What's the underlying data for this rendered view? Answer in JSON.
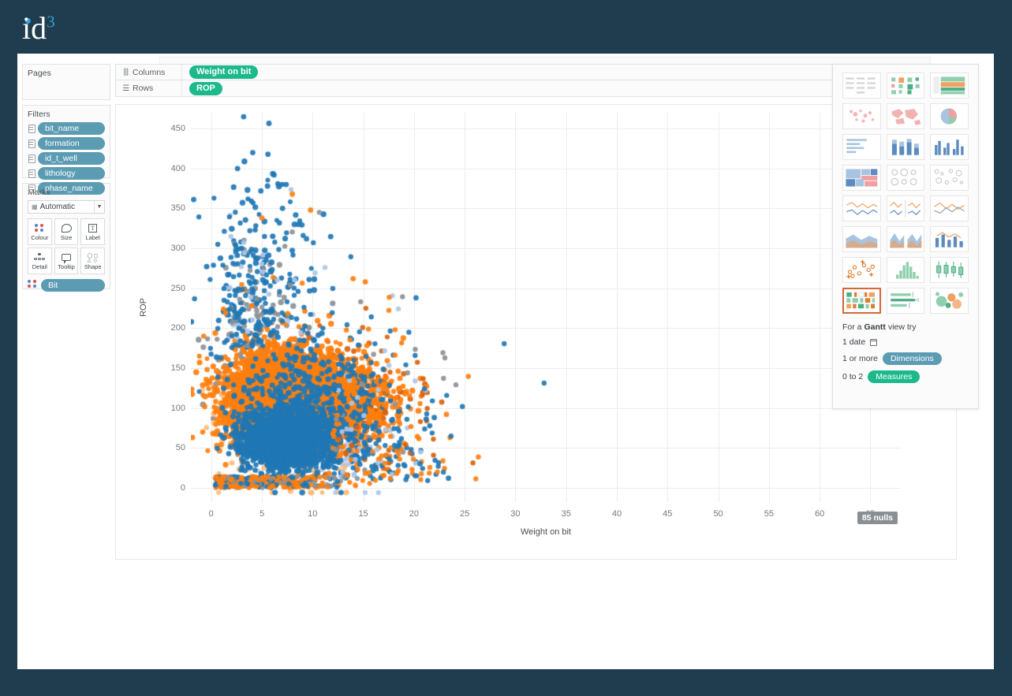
{
  "brand": {
    "text": "id",
    "sup": "3"
  },
  "shelves": [
    {
      "icon": "columns-icon",
      "name": "Columns",
      "pill": "Weight on bit"
    },
    {
      "icon": "rows-icon",
      "name": "Rows",
      "pill": "ROP"
    }
  ],
  "pages": {
    "title": "Pages"
  },
  "filters": {
    "title": "Filters",
    "items": [
      "bit_name",
      "formation",
      "id_t_well",
      "lithology",
      "phase_name"
    ]
  },
  "marks": {
    "title": "Marks",
    "type": "Automatic",
    "buttons": [
      {
        "label": "Colour",
        "icon": "colour-dots-icon"
      },
      {
        "label": "Size",
        "icon": "size-icon"
      },
      {
        "label": "Label",
        "icon": "label-icon"
      },
      {
        "label": "Detail",
        "icon": "detail-icon"
      },
      {
        "label": "Tooltip",
        "icon": "tooltip-icon"
      },
      {
        "label": "Shape",
        "icon": "shape-icon"
      }
    ],
    "pill": "Bit"
  },
  "showme": {
    "thumbnails": [
      "text-table",
      "heat-map",
      "highlight-table",
      "symbol-map",
      "filled-map",
      "pie-chart",
      "horizontal-bars",
      "stacked-bars",
      "side-by-side-bars",
      "treemap",
      "circle-views",
      "side-by-side-circles",
      "lines-continuous",
      "lines-discrete",
      "dual-lines",
      "area-continuous",
      "area-discrete",
      "dual-combination",
      "scatter-plot",
      "histogram",
      "box-and-whisker",
      "gantt-chart",
      "bullet-graph",
      "packed-bubbles"
    ],
    "selected_index": 21,
    "hint": {
      "line1_prefix": "For a",
      "line1_bold": "Gantt",
      "line1_suffix": "view try",
      "line2": "1 date",
      "line3_prefix": "1 or more",
      "line3_pill": "Dimensions",
      "line4_prefix": "0 to 2",
      "line4_pill": "Measures"
    }
  },
  "nulls_badge": "85 nulls",
  "colors": {
    "page_bg": "#1f3d4f",
    "pill_green": "#1cb98c",
    "pill_blue": "#5c9cb3",
    "accent_orange": "#ff7f0e",
    "accent_blue": "#1f77b4",
    "highlight_border": "#d4663a"
  },
  "chart_data": {
    "type": "scatter",
    "title": "",
    "xlabel": "Weight on bit",
    "ylabel": "ROP",
    "xlim": [
      -2,
      68
    ],
    "ylim": [
      -18,
      470
    ],
    "xticks": [
      0,
      5,
      10,
      15,
      20,
      25,
      30,
      35,
      40,
      45,
      50,
      55,
      60,
      65
    ],
    "yticks": [
      0,
      50,
      100,
      150,
      200,
      250,
      300,
      350,
      400,
      450
    ],
    "grid": true,
    "legend": "none",
    "annotations": [
      "85 nulls"
    ],
    "series": [
      {
        "name": "blue-dark",
        "color": "#1f77b4",
        "n": 3200
      },
      {
        "name": "orange",
        "color": "#ff7f0e",
        "n": 4200
      },
      {
        "name": "blue-light",
        "color": "#aec7e8",
        "n": 260
      },
      {
        "name": "orange-light",
        "color": "#ffbb78",
        "n": 150
      },
      {
        "name": "grey",
        "color": "#8c9196",
        "n": 260
      },
      {
        "name": "orange-dark",
        "color": "#d9620c",
        "n": 420
      }
    ],
    "clusters": [
      {
        "series": "orange",
        "cx": 7.0,
        "cy": 112,
        "sx": 2.9,
        "sy": 30,
        "n": 3100
      },
      {
        "series": "orange",
        "cx": 12.0,
        "cy": 110,
        "sx": 3.0,
        "sy": 28,
        "n": 800
      },
      {
        "series": "blue-dark",
        "cx": 7.2,
        "cy": 60,
        "sx": 2.1,
        "sy": 16,
        "n": 2100
      },
      {
        "series": "blue-dark",
        "cx": 9.5,
        "cy": 95,
        "sx": 3.5,
        "sy": 38,
        "n": 500
      },
      {
        "series": "blue-dark",
        "cx": 5.0,
        "cy": 250,
        "sx": 3.0,
        "sy": 70,
        "n": 160
      },
      {
        "series": "grey",
        "cx": 5.5,
        "cy": 150,
        "sx": 2.6,
        "sy": 55,
        "n": 200
      },
      {
        "series": "orange-dark",
        "cx": 11.5,
        "cy": 110,
        "sx": 3.5,
        "sy": 30,
        "n": 400
      },
      {
        "series": "blue-light",
        "cx": 10.0,
        "cy": 70,
        "sx": 3.0,
        "sy": 35,
        "n": 230
      },
      {
        "series": "orange-light",
        "cx": 8.0,
        "cy": 80,
        "sx": 3.5,
        "sy": 45,
        "n": 140
      }
    ]
  }
}
